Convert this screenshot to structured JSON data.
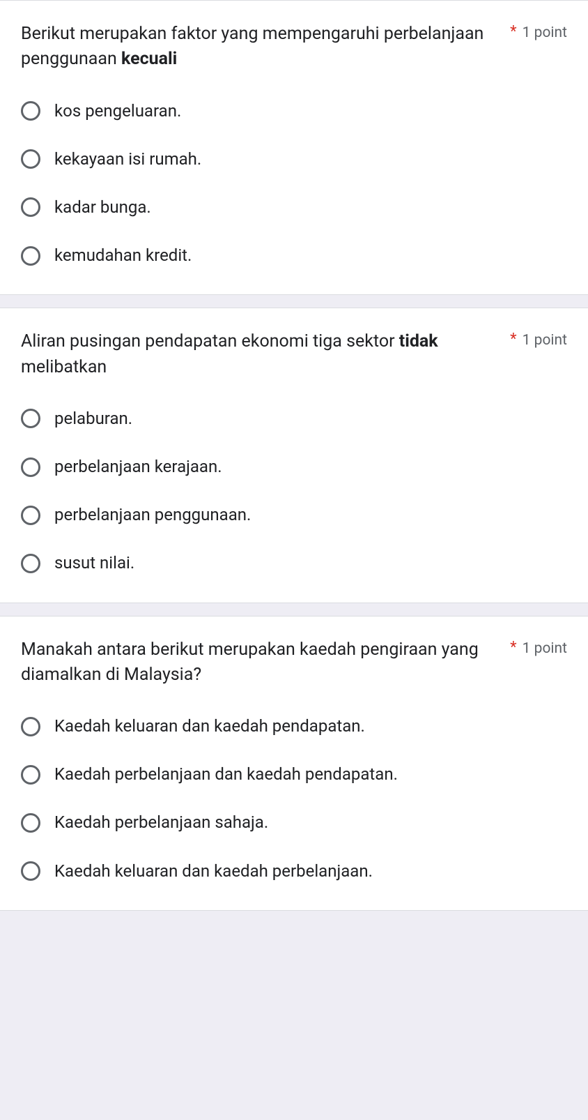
{
  "required_marker": "*",
  "questions": [
    {
      "text_pre": "Berikut merupakan faktor yang mempengaruhi perbelanjaan penggunaan ",
      "text_bold": "kecuali",
      "text_post": "",
      "points": "1 point",
      "options": [
        "kos pengeluaran.",
        "kekayaan isi rumah.",
        "kadar bunga.",
        "kemudahan kredit."
      ]
    },
    {
      "text_pre": "Aliran pusingan pendapatan ekonomi tiga sektor ",
      "text_bold": "tidak",
      "text_post": " melibatkan",
      "points": "1 point",
      "options": [
        "pelaburan.",
        "perbelanjaan kerajaan.",
        "perbelanjaan penggunaan.",
        "susut nilai."
      ]
    },
    {
      "text_pre": "Manakah antara berikut merupakan kaedah pengiraan yang diamalkan di Malaysia?",
      "text_bold": "",
      "text_post": "",
      "points": "1 point",
      "options": [
        "Kaedah keluaran dan kaedah pendapatan.",
        "Kaedah perbelanjaan dan kaedah pendapatan.",
        "Kaedah perbelanjaan sahaja.",
        "Kaedah keluaran dan kaedah perbelanjaan."
      ]
    }
  ]
}
